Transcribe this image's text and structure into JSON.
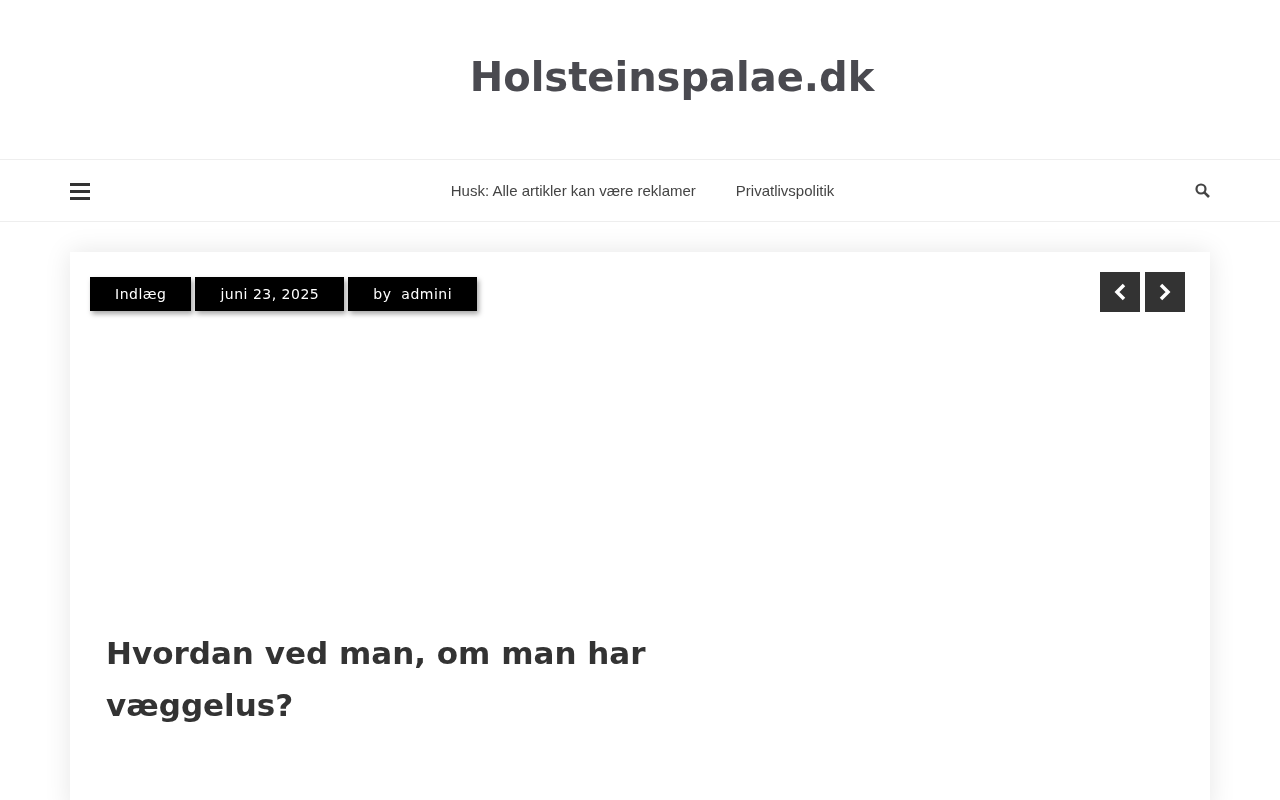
{
  "site_title": "Holsteinspalae.dk",
  "nav": {
    "items": [
      {
        "label": "Husk: Alle artikler kan være reklamer"
      },
      {
        "label": "Privatlivspolitik"
      }
    ]
  },
  "post": {
    "meta": [
      "Indlæg",
      "juni 23, 2025",
      "by  admini"
    ],
    "title": "Hvordan ved man, om man har væggelus?"
  }
}
